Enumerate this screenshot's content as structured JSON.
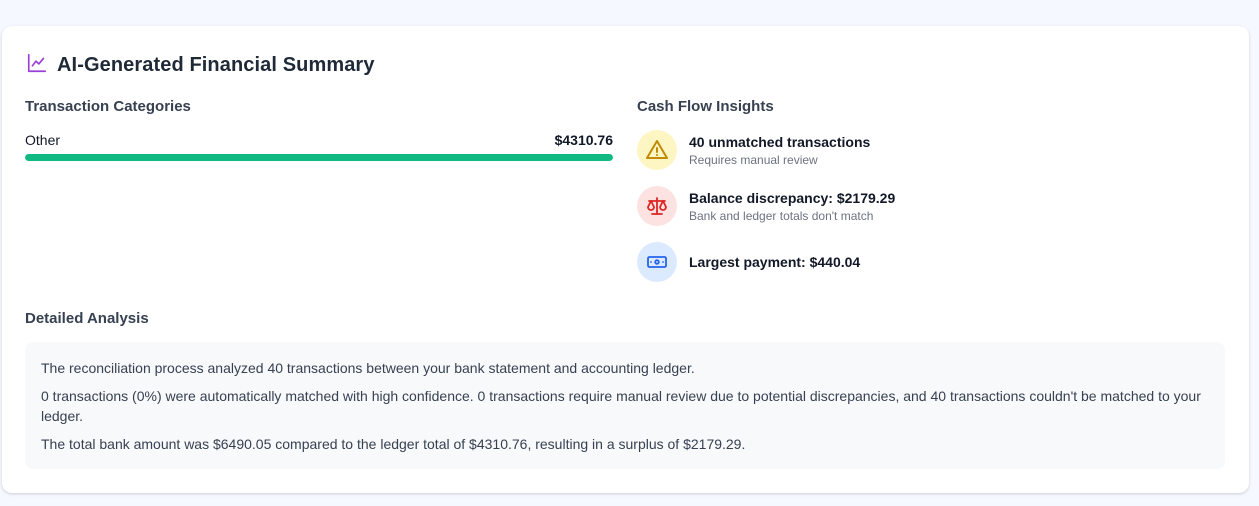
{
  "header": {
    "title": "AI-Generated Financial Summary",
    "icon": "chart-line-icon",
    "accent_color": "#9b3dd8"
  },
  "categories": {
    "title": "Transaction Categories",
    "items": [
      {
        "label": "Other",
        "amount": "$4310.76",
        "share": 1.0,
        "color": "#10b981"
      }
    ]
  },
  "insights": {
    "title": "Cash Flow Insights",
    "items": [
      {
        "main": "40 unmatched transactions",
        "sub": "Requires manual review",
        "icon": "warning-icon",
        "bg": "#fdf6c3",
        "fg": "#c08a05"
      },
      {
        "main": "Balance discrepancy: $2179.29",
        "sub": "Bank and ledger totals don't match",
        "icon": "scale-icon",
        "bg": "#fde2e2",
        "fg": "#dc2626"
      },
      {
        "main": "Largest payment: $440.04",
        "sub": "",
        "icon": "cash-icon",
        "bg": "#dbeafe",
        "fg": "#2563eb"
      }
    ]
  },
  "analysis": {
    "title": "Detailed Analysis",
    "paragraphs": [
      "The reconciliation process analyzed 40 transactions between your bank statement and accounting ledger.",
      "0 transactions (0%) were automatically matched with high confidence. 0 transactions require manual review due to potential discrepancies, and 40 transactions couldn't be matched to your ledger.",
      "The total bank amount was $6490.05 compared to the ledger total of $4310.76, resulting in a surplus of $2179.29."
    ]
  }
}
